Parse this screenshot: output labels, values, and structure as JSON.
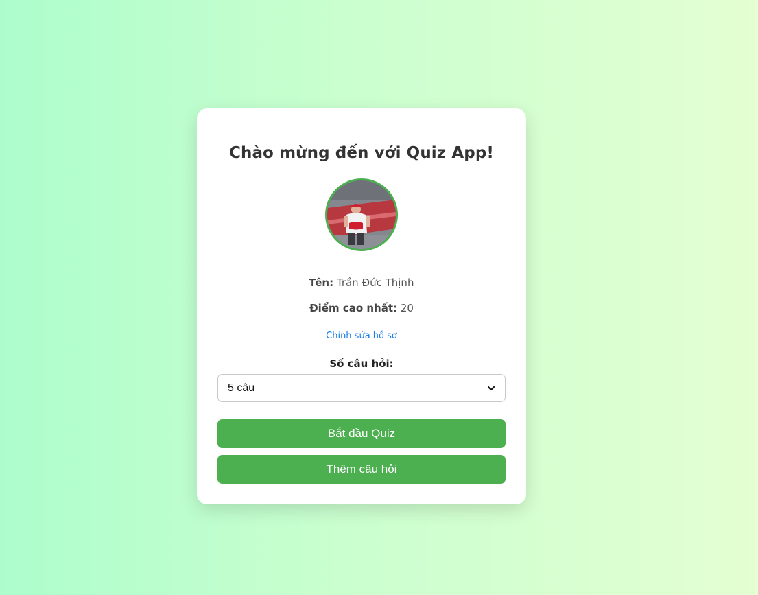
{
  "title": "Chào mừng đến với Quiz App!",
  "profile": {
    "name_label": "Tên:",
    "name_value": "Trần Đức Thịnh",
    "score_label": "Điểm cao nhất:",
    "score_value": "20",
    "edit_link": "Chỉnh sửa hồ sơ"
  },
  "question_count": {
    "label": "Số câu hỏi:",
    "selected": "5 câu"
  },
  "buttons": {
    "start": "Bắt đầu Quiz",
    "add_question": "Thêm câu hỏi"
  },
  "colors": {
    "accent": "#4caf50",
    "link": "#1a7ee6"
  },
  "icons": {
    "select_arrow": "chevron-down-icon"
  }
}
